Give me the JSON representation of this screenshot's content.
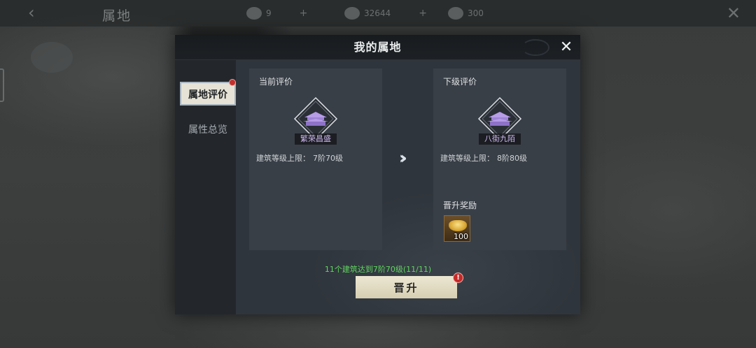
{
  "hud": {
    "title": "属地",
    "resources": [
      {
        "name": "resource-1",
        "value": "9"
      },
      {
        "name": "resource-2",
        "value": "32644"
      },
      {
        "name": "resource-3",
        "value": "300"
      }
    ]
  },
  "modal": {
    "title": "我的属地",
    "tabs": [
      {
        "label": "属地评价",
        "active": true,
        "alert": true
      },
      {
        "label": "属性总览",
        "active": false,
        "alert": false
      }
    ],
    "current": {
      "header": "当前评价",
      "rank": "繁荣昌盛",
      "stat_label": "建筑等级上限：",
      "stat_value": "7阶70级"
    },
    "next": {
      "header": "下级评价",
      "rank": "八街九陌",
      "stat_label": "建筑等级上限：",
      "stat_value": "8阶80级",
      "reward_header": "晋升奖励",
      "reward_item": "gold-ingot-icon",
      "reward_count": "100"
    },
    "progress_text": "11个建筑达到7阶70级(11/11)",
    "promote_label": "晋升",
    "promote_alert": "!"
  },
  "colors": {
    "rank_purple": "#b79ce8",
    "progress_green": "#5fd65f",
    "alert_red": "#c62a28"
  }
}
